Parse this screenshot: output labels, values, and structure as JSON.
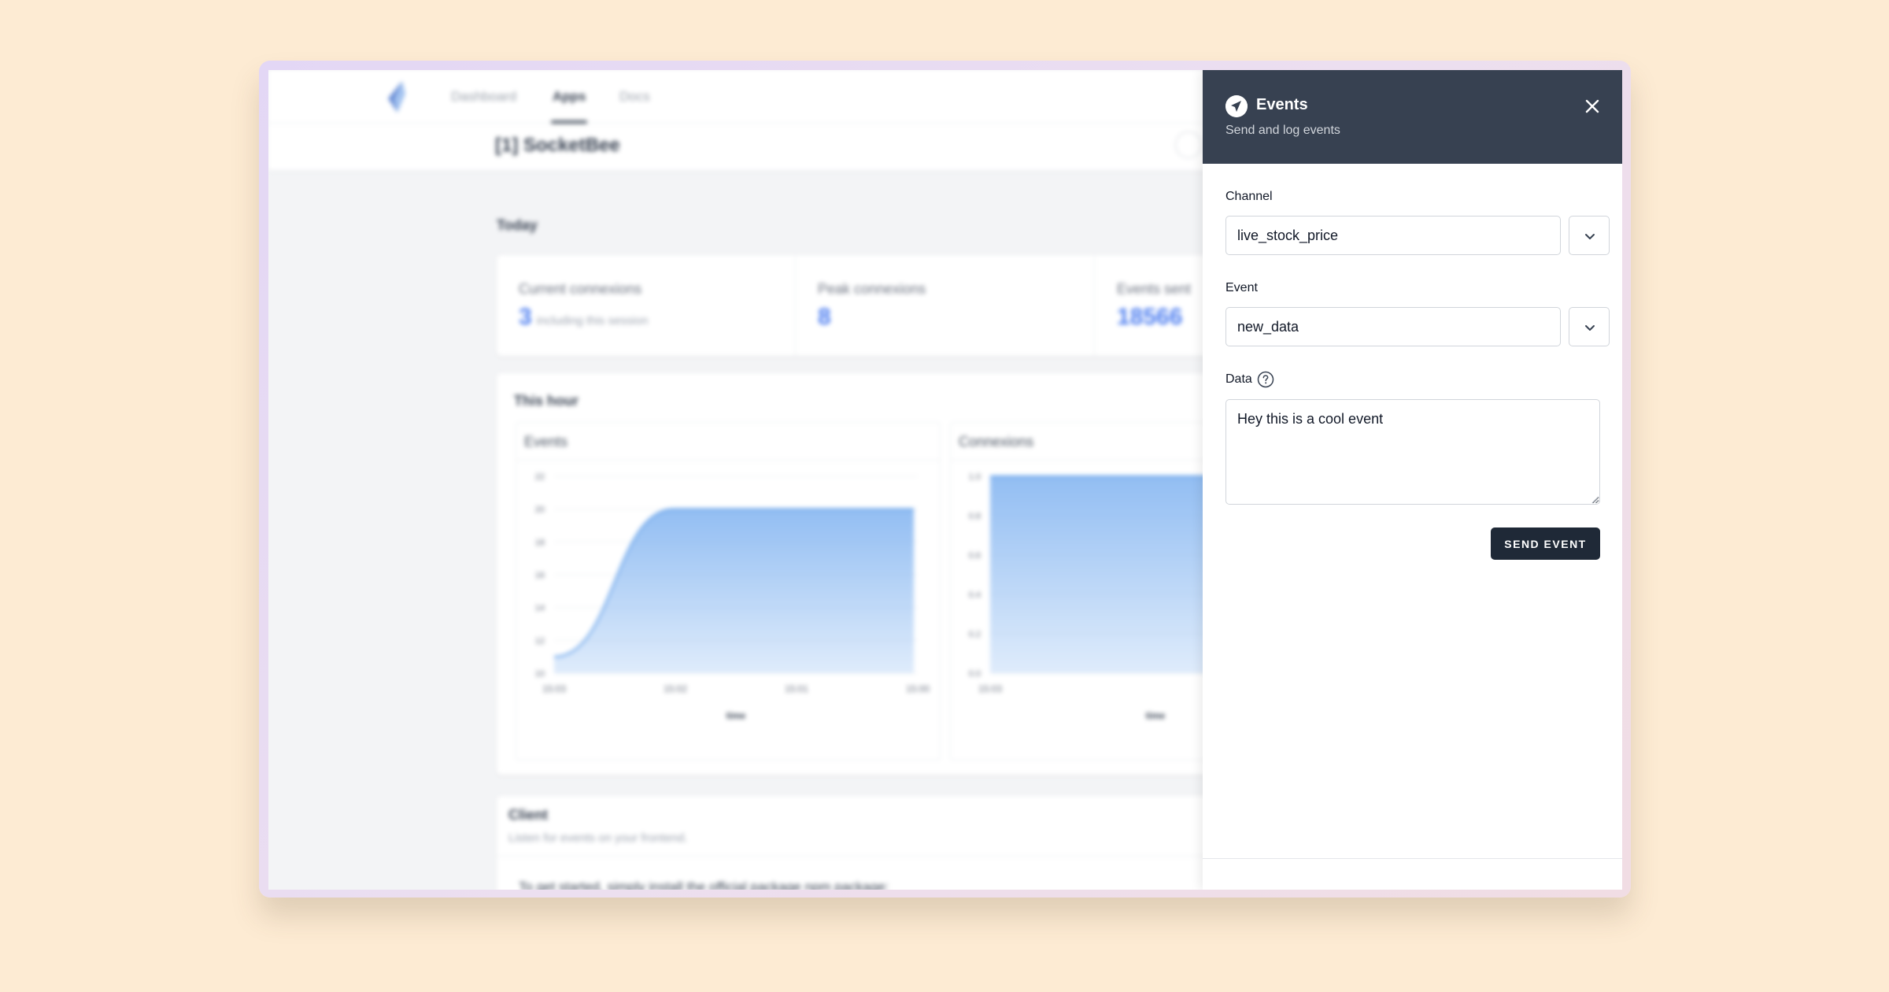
{
  "nav": {
    "links": [
      "Dashboard",
      "Apps",
      "Docs"
    ],
    "active": "Apps"
  },
  "app": {
    "title": "[1] SocketBee"
  },
  "today": {
    "heading": "Today",
    "stats": [
      {
        "label": "Current connexions",
        "value": "3",
        "sub": "including this session"
      },
      {
        "label": "Peak connexions",
        "value": "8",
        "sub": ""
      },
      {
        "label": "Events sent",
        "value": "18566",
        "sub": ""
      }
    ]
  },
  "this_hour": {
    "heading": "This hour"
  },
  "chart_data": [
    {
      "type": "area",
      "title": "Events",
      "xlabel": "time",
      "ylabel": "",
      "x": [
        "15:03",
        "15:02",
        "15:01",
        "15:00"
      ],
      "y_ticks": [
        "22",
        "20",
        "18",
        "16",
        "14",
        "12",
        "10"
      ],
      "ylim": [
        10,
        22
      ],
      "values": [
        11,
        20,
        20,
        20
      ],
      "color": "#7fb2f0"
    },
    {
      "type": "area",
      "title": "Connexions",
      "xlabel": "time",
      "ylabel": "",
      "x": [
        "15:03"
      ],
      "y_ticks": [
        "1.0",
        "0.8",
        "0.6",
        "0.4",
        "0.2",
        "0.0"
      ],
      "ylim": [
        0,
        1
      ],
      "values": [
        1,
        1
      ],
      "color": "#7fb2f0"
    }
  ],
  "client": {
    "title": "Client",
    "subtitle": "Listen for events on your frontend.",
    "text": "To get started, simply install the official package npm package:"
  },
  "drawer": {
    "title": "Events",
    "subtitle": "Send and log events",
    "channel_label": "Channel",
    "channel_value": "live_stock_price",
    "event_label": "Event",
    "event_value": "new_data",
    "data_label": "Data",
    "data_value": "Hey this is a cool event",
    "send_label": "SEND EVENT",
    "header_color": "#374151",
    "send_color": "#1f2937"
  }
}
